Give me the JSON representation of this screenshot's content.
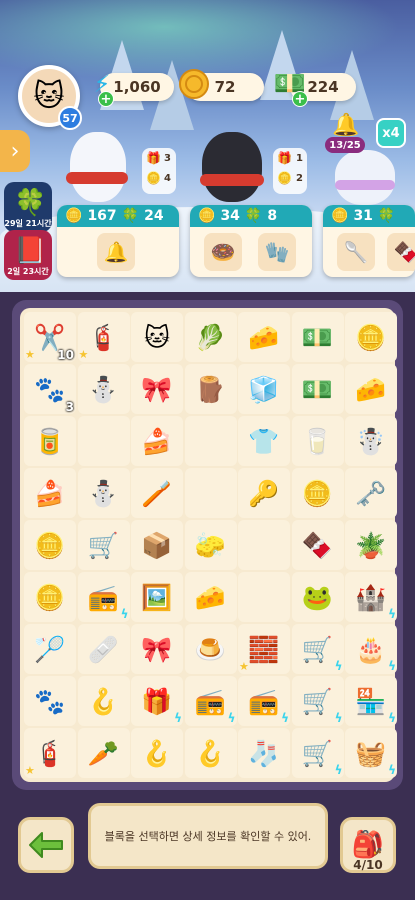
{
  "resources": {
    "energy": "1,060",
    "coins": "72",
    "cash": "224"
  },
  "player": {
    "level": "57"
  },
  "events": [
    {
      "label": "29일 21시간"
    },
    {
      "label": "2일 23시간"
    }
  ],
  "requests": [
    {
      "a": "3",
      "b": "4"
    },
    {
      "a": "1",
      "b": "2"
    }
  ],
  "orders": [
    {
      "coins": "167",
      "clover": "24"
    },
    {
      "coins": "34",
      "clover": "8"
    },
    {
      "coins": "31",
      "clover": ""
    }
  ],
  "progress_pill": "13/25",
  "multiplier": "x4",
  "colors": {
    "order_header": "#21a9b6",
    "board_bg": "#f7ead0",
    "frame": "#5a4a78"
  },
  "board": {
    "rows": [
      [
        {
          "i": "✂️",
          "c": "10",
          "s": true
        },
        {
          "i": "🧯",
          "s": true
        },
        {
          "i": "🐱"
        },
        {
          "i": "🥬"
        },
        {
          "i": "🧀"
        },
        {
          "i": "💵"
        },
        {
          "i": "🪙"
        }
      ],
      [
        {
          "i": "🐾",
          "c": "3"
        },
        {
          "i": "⛄"
        },
        {
          "i": "🎀"
        },
        {
          "i": "🪵"
        },
        {
          "i": "🧊"
        },
        {
          "i": "💵"
        },
        {
          "i": "🧀"
        }
      ],
      [
        {
          "i": "🥫"
        },
        {
          "i": ""
        },
        {
          "i": "🍰"
        },
        {
          "i": ""
        },
        {
          "i": "👕"
        },
        {
          "i": "🥛"
        },
        {
          "i": "☃️"
        }
      ],
      [
        {
          "i": "🍰"
        },
        {
          "i": "⛄"
        },
        {
          "i": "🪥"
        },
        {
          "i": ""
        },
        {
          "i": "🔑"
        },
        {
          "i": "🪙"
        },
        {
          "i": "🗝️"
        }
      ],
      [
        {
          "i": "🪙"
        },
        {
          "i": "🛒"
        },
        {
          "i": "📦"
        },
        {
          "i": "🧽"
        },
        {
          "i": ""
        },
        {
          "i": "🍫"
        },
        {
          "i": "🪴"
        }
      ],
      [
        {
          "i": "🪙"
        },
        {
          "i": "📻",
          "b": true
        },
        {
          "i": "🖼️"
        },
        {
          "i": "🧀"
        },
        {
          "i": ""
        },
        {
          "i": "🐸"
        },
        {
          "i": "🏰",
          "b": true
        }
      ],
      [
        {
          "i": "🏸"
        },
        {
          "i": "🩹"
        },
        {
          "i": "🎀"
        },
        {
          "i": "🍮"
        },
        {
          "i": "🧱",
          "s": true
        },
        {
          "i": "🛒",
          "b": true
        },
        {
          "i": "🎂",
          "b": true
        }
      ],
      [
        {
          "i": "🐾"
        },
        {
          "i": "🪝"
        },
        {
          "i": "🎁",
          "b": true
        },
        {
          "i": "📻",
          "b": true
        },
        {
          "i": "📻",
          "b": true
        },
        {
          "i": "🛒",
          "b": true
        },
        {
          "i": "🏪",
          "b": true
        }
      ],
      [
        {
          "i": "🧯",
          "s": true
        },
        {
          "i": "🥕"
        },
        {
          "i": "🪝"
        },
        {
          "i": "🪝"
        },
        {
          "i": "🧦"
        },
        {
          "i": "🛒",
          "b": true
        },
        {
          "i": "🧺",
          "b": true
        }
      ]
    ]
  },
  "info_text": "블록을 선택하면 상세 정보를 확인할 수 있어.",
  "inventory": {
    "count": "4/10"
  }
}
